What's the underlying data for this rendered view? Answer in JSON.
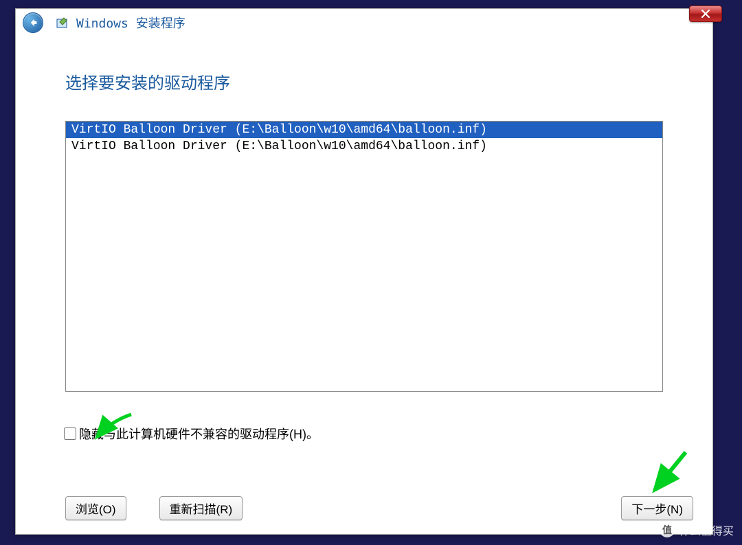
{
  "titlebar": {
    "title": "Windows 安装程序"
  },
  "heading": "选择要安装的驱动程序",
  "drivers": [
    {
      "label": "VirtIO Balloon Driver (E:\\Balloon\\w10\\amd64\\balloon.inf)",
      "selected": true
    },
    {
      "label": "VirtIO Balloon Driver (E:\\Balloon\\w10\\amd64\\balloon.inf)",
      "selected": false
    }
  ],
  "checkbox": {
    "label": "隐藏与此计算机硬件不兼容的驱动程序(H)。",
    "checked": false
  },
  "buttons": {
    "browse": "浏览(O)",
    "rescan": "重新扫描(R)",
    "next": "下一步(N)"
  },
  "watermark": "什么值得买"
}
